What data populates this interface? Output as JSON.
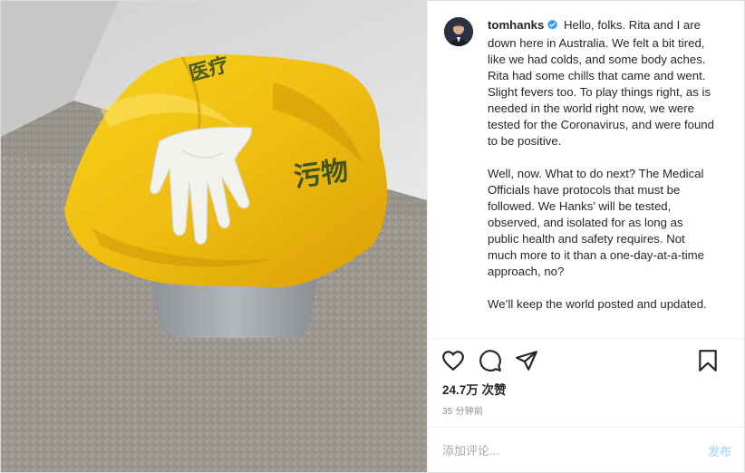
{
  "post": {
    "username": "tomhanks",
    "verified": true,
    "caption_paragraphs": [
      "Hello, folks. Rita and I are down here in Australia. We felt a bit tired, like we had colds, and some body aches. Rita had some chills that came and went. Slight fevers too. To play things right, as is needed in the world right now, we were tested for the Coronavirus, and were found to be positive.",
      "Well, now. What to do next? The Medical Officials have protocols that must be followed. We Hanks’ will be tested, observed, and isolated for as long as public health and safety requires. Not much more to it than a one-day-at-a-time approach, no?",
      "We’ll keep the world posted and updated."
    ],
    "likes": "24.7万 次赞",
    "timestamp": "35 分钟前"
  },
  "actions": {
    "like_icon": "heart-icon",
    "comment_icon": "comment-icon",
    "share_icon": "share-icon",
    "save_icon": "bookmark-icon"
  },
  "comment": {
    "placeholder": "添加评论...",
    "post_label": "发布"
  },
  "photo": {
    "bag_text_1": "污物",
    "bag_text_2": "医疗"
  },
  "colors": {
    "verified": "#3897f0",
    "post_disabled": "#b2dffc",
    "bag_yellow": "#f5c518",
    "text_primary": "#262626",
    "text_secondary": "#8e8e8e"
  }
}
